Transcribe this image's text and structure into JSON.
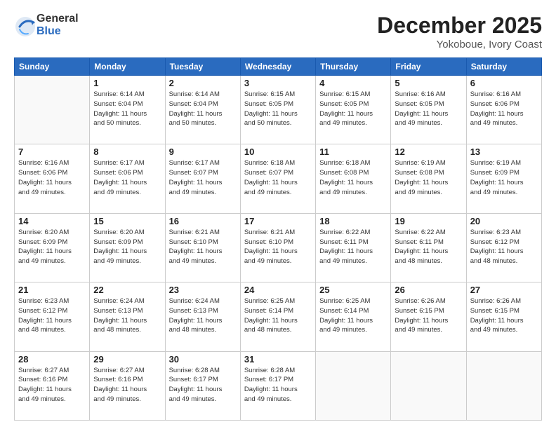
{
  "header": {
    "logo_general": "General",
    "logo_blue": "Blue",
    "month": "December 2025",
    "location": "Yokoboue, Ivory Coast"
  },
  "days_of_week": [
    "Sunday",
    "Monday",
    "Tuesday",
    "Wednesday",
    "Thursday",
    "Friday",
    "Saturday"
  ],
  "weeks": [
    [
      {
        "day": "",
        "info": ""
      },
      {
        "day": "1",
        "info": "Sunrise: 6:14 AM\nSunset: 6:04 PM\nDaylight: 11 hours\nand 50 minutes."
      },
      {
        "day": "2",
        "info": "Sunrise: 6:14 AM\nSunset: 6:04 PM\nDaylight: 11 hours\nand 50 minutes."
      },
      {
        "day": "3",
        "info": "Sunrise: 6:15 AM\nSunset: 6:05 PM\nDaylight: 11 hours\nand 50 minutes."
      },
      {
        "day": "4",
        "info": "Sunrise: 6:15 AM\nSunset: 6:05 PM\nDaylight: 11 hours\nand 49 minutes."
      },
      {
        "day": "5",
        "info": "Sunrise: 6:16 AM\nSunset: 6:05 PM\nDaylight: 11 hours\nand 49 minutes."
      },
      {
        "day": "6",
        "info": "Sunrise: 6:16 AM\nSunset: 6:06 PM\nDaylight: 11 hours\nand 49 minutes."
      }
    ],
    [
      {
        "day": "7",
        "info": "Sunrise: 6:16 AM\nSunset: 6:06 PM\nDaylight: 11 hours\nand 49 minutes."
      },
      {
        "day": "8",
        "info": "Sunrise: 6:17 AM\nSunset: 6:06 PM\nDaylight: 11 hours\nand 49 minutes."
      },
      {
        "day": "9",
        "info": "Sunrise: 6:17 AM\nSunset: 6:07 PM\nDaylight: 11 hours\nand 49 minutes."
      },
      {
        "day": "10",
        "info": "Sunrise: 6:18 AM\nSunset: 6:07 PM\nDaylight: 11 hours\nand 49 minutes."
      },
      {
        "day": "11",
        "info": "Sunrise: 6:18 AM\nSunset: 6:08 PM\nDaylight: 11 hours\nand 49 minutes."
      },
      {
        "day": "12",
        "info": "Sunrise: 6:19 AM\nSunset: 6:08 PM\nDaylight: 11 hours\nand 49 minutes."
      },
      {
        "day": "13",
        "info": "Sunrise: 6:19 AM\nSunset: 6:09 PM\nDaylight: 11 hours\nand 49 minutes."
      }
    ],
    [
      {
        "day": "14",
        "info": "Sunrise: 6:20 AM\nSunset: 6:09 PM\nDaylight: 11 hours\nand 49 minutes."
      },
      {
        "day": "15",
        "info": "Sunrise: 6:20 AM\nSunset: 6:09 PM\nDaylight: 11 hours\nand 49 minutes."
      },
      {
        "day": "16",
        "info": "Sunrise: 6:21 AM\nSunset: 6:10 PM\nDaylight: 11 hours\nand 49 minutes."
      },
      {
        "day": "17",
        "info": "Sunrise: 6:21 AM\nSunset: 6:10 PM\nDaylight: 11 hours\nand 49 minutes."
      },
      {
        "day": "18",
        "info": "Sunrise: 6:22 AM\nSunset: 6:11 PM\nDaylight: 11 hours\nand 49 minutes."
      },
      {
        "day": "19",
        "info": "Sunrise: 6:22 AM\nSunset: 6:11 PM\nDaylight: 11 hours\nand 48 minutes."
      },
      {
        "day": "20",
        "info": "Sunrise: 6:23 AM\nSunset: 6:12 PM\nDaylight: 11 hours\nand 48 minutes."
      }
    ],
    [
      {
        "day": "21",
        "info": "Sunrise: 6:23 AM\nSunset: 6:12 PM\nDaylight: 11 hours\nand 48 minutes."
      },
      {
        "day": "22",
        "info": "Sunrise: 6:24 AM\nSunset: 6:13 PM\nDaylight: 11 hours\nand 48 minutes."
      },
      {
        "day": "23",
        "info": "Sunrise: 6:24 AM\nSunset: 6:13 PM\nDaylight: 11 hours\nand 48 minutes."
      },
      {
        "day": "24",
        "info": "Sunrise: 6:25 AM\nSunset: 6:14 PM\nDaylight: 11 hours\nand 48 minutes."
      },
      {
        "day": "25",
        "info": "Sunrise: 6:25 AM\nSunset: 6:14 PM\nDaylight: 11 hours\nand 49 minutes."
      },
      {
        "day": "26",
        "info": "Sunrise: 6:26 AM\nSunset: 6:15 PM\nDaylight: 11 hours\nand 49 minutes."
      },
      {
        "day": "27",
        "info": "Sunrise: 6:26 AM\nSunset: 6:15 PM\nDaylight: 11 hours\nand 49 minutes."
      }
    ],
    [
      {
        "day": "28",
        "info": "Sunrise: 6:27 AM\nSunset: 6:16 PM\nDaylight: 11 hours\nand 49 minutes."
      },
      {
        "day": "29",
        "info": "Sunrise: 6:27 AM\nSunset: 6:16 PM\nDaylight: 11 hours\nand 49 minutes."
      },
      {
        "day": "30",
        "info": "Sunrise: 6:28 AM\nSunset: 6:17 PM\nDaylight: 11 hours\nand 49 minutes."
      },
      {
        "day": "31",
        "info": "Sunrise: 6:28 AM\nSunset: 6:17 PM\nDaylight: 11 hours\nand 49 minutes."
      },
      {
        "day": "",
        "info": ""
      },
      {
        "day": "",
        "info": ""
      },
      {
        "day": "",
        "info": ""
      }
    ]
  ]
}
